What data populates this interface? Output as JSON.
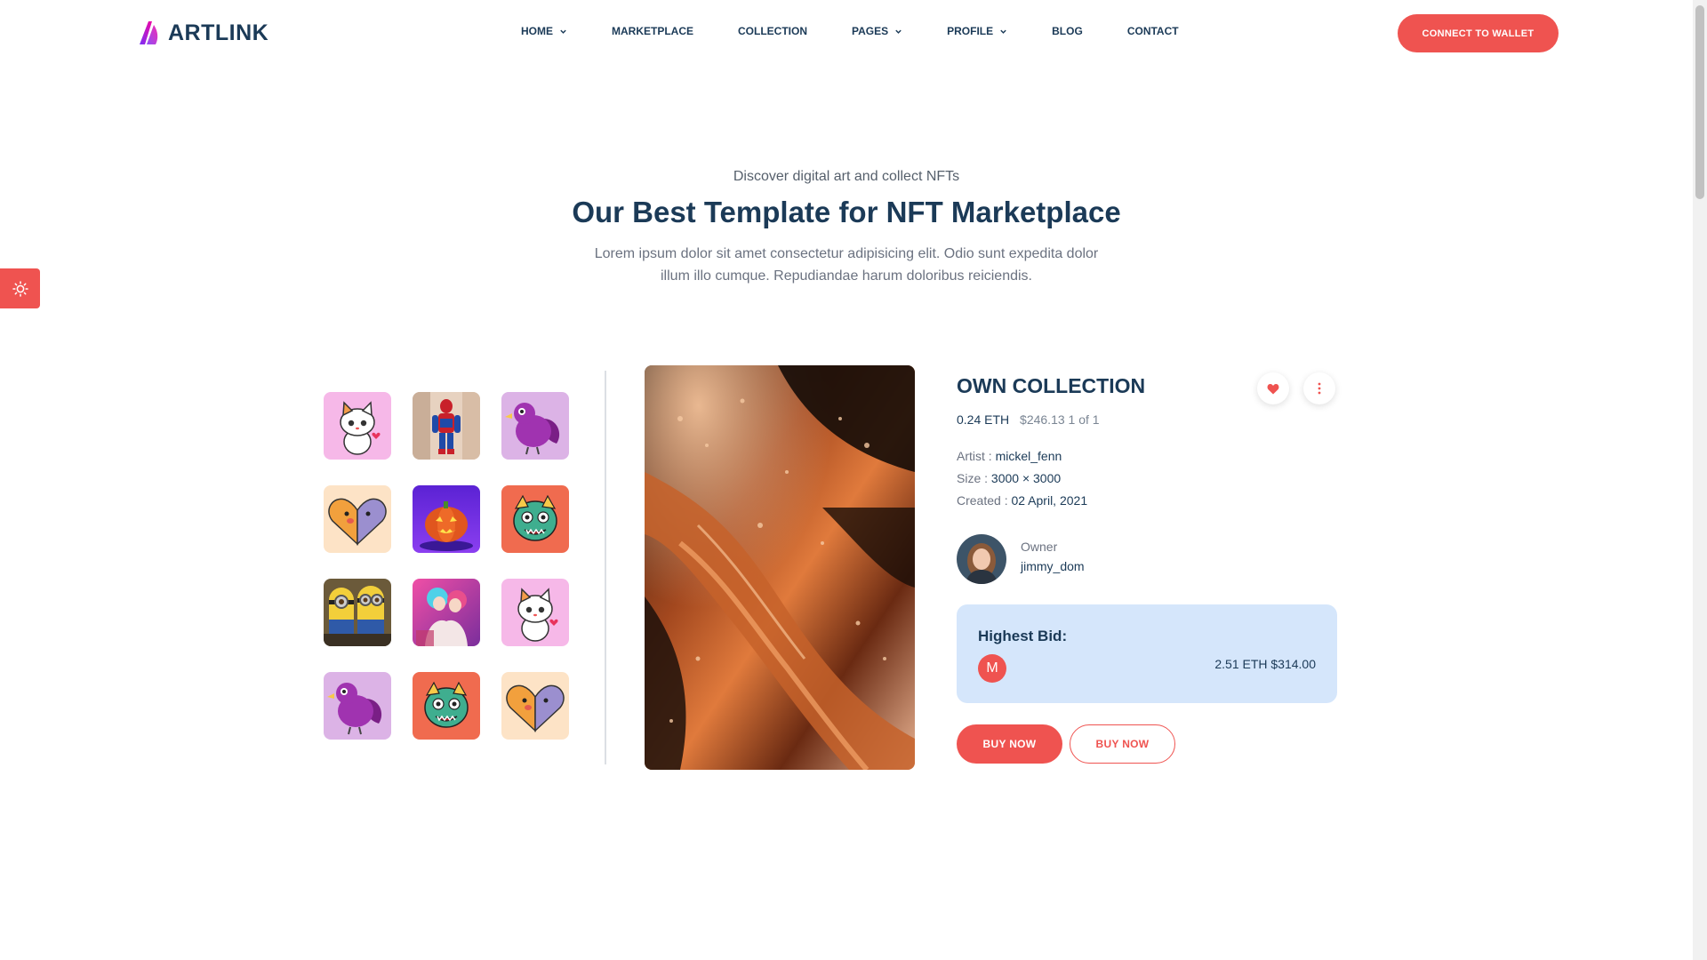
{
  "brand": {
    "name": "ARTLINK",
    "accent": "#ef5350",
    "navy": "#1b3a57"
  },
  "nav": {
    "items": [
      {
        "label": "HOME",
        "has_dropdown": true
      },
      {
        "label": "MARKETPLACE",
        "has_dropdown": false
      },
      {
        "label": "COLLECTION",
        "has_dropdown": false
      },
      {
        "label": "PAGES",
        "has_dropdown": true
      },
      {
        "label": "PROFILE",
        "has_dropdown": true
      },
      {
        "label": "BLOG",
        "has_dropdown": false
      },
      {
        "label": "CONTACT",
        "has_dropdown": false
      }
    ],
    "cta": "CONNECT TO WALLET"
  },
  "theme_toggle": {
    "icon": "sun-icon"
  },
  "hero": {
    "subtitle": "Discover digital art and collect NFTs",
    "title": "Our Best Template for NFT Marketplace",
    "description": "Lorem ipsum dolor sit amet consectetur adipisicing elit. Odio sunt expedita dolor illum illo cumque. Repudiandae harum doloribus reiciendis."
  },
  "thumbnails": [
    {
      "name": "cat-thumb",
      "bg": "#f6b8e8"
    },
    {
      "name": "spiderman-thumb",
      "bg": "#e7d2c0"
    },
    {
      "name": "purple-bird-thumb",
      "bg": "#dcb3e6"
    },
    {
      "name": "dog-cat-heart-thumb",
      "bg": "#fde3c6"
    },
    {
      "name": "pumpkin-thumb",
      "bg": "#6d2fd6"
    },
    {
      "name": "lion-dance-thumb",
      "bg": "#f06b4f"
    },
    {
      "name": "minions-thumb",
      "bg": "#e9c94a"
    },
    {
      "name": "anime-couple-thumb",
      "bg": "#d94f9a"
    },
    {
      "name": "cat-thumb",
      "bg": "#f6b8e8"
    },
    {
      "name": "purple-bird-thumb",
      "bg": "#dcb3e6"
    },
    {
      "name": "lion-dance-thumb",
      "bg": "#f06b4f"
    },
    {
      "name": "dog-cat-heart-thumb",
      "bg": "#fde3c6"
    }
  ],
  "item": {
    "title": "OWN COLLECTION",
    "eth_price": "0.24 ETH",
    "usd_price": "$246.13 1 of 1",
    "artist_label": "Artist :",
    "artist": "mickel_fenn",
    "size_label": "Size :",
    "size": "3000 × 3000",
    "created_label": "Created :",
    "created": "02 April, 2021",
    "owner_label": "Owner",
    "owner": "jimmy_dom",
    "bid_title": "Highest Bid:",
    "bidder_initial": "M",
    "bid_amount": "2.51 ETH $314.00",
    "buy_primary": "BUY NOW",
    "buy_secondary": "BUY NOW"
  }
}
